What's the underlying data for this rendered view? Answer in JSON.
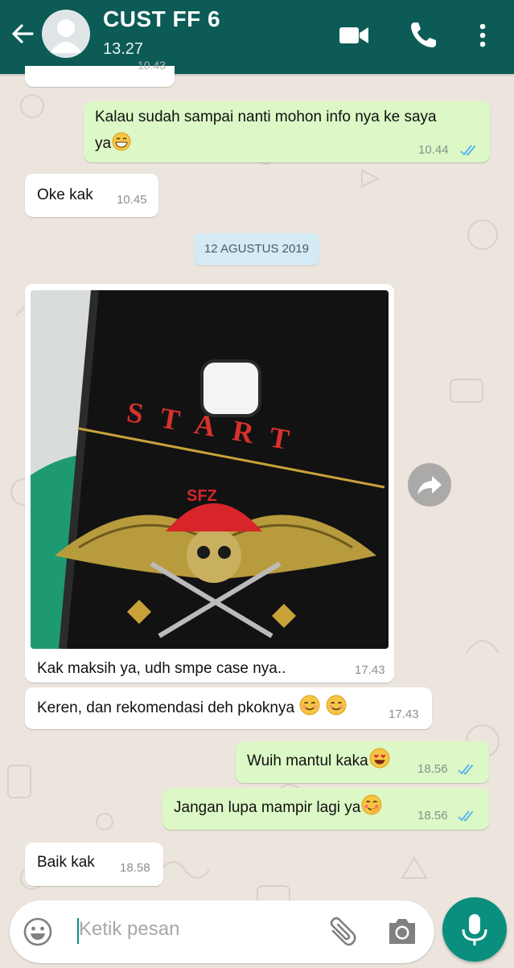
{
  "header": {
    "contact_name": "CUST FF 6",
    "last_seen": "13.27",
    "back_icon": "arrow-left-icon",
    "video_icon": "video-camera-icon",
    "call_icon": "phone-icon",
    "menu_icon": "more-vertical-icon"
  },
  "messages": {
    "partial_time": "10.43",
    "m1_line1": "Kalau sudah sampai nanti mohon info nya ke saya",
    "m1_line2": "ya",
    "m1_time": "10.44",
    "m2_text": "Oke kak",
    "m2_time": "10.45",
    "date_divider": "12 AGUSTUS 2019",
    "m3_caption": "Kak maksih ya, udh smpe case nya..",
    "m3_time": "17.43",
    "m3_image": {
      "case_top_text": "START",
      "case_emblem_text": "SFZ"
    },
    "m4_text": "Keren, dan rekomendasi deh pkoknya",
    "m4_time": "17.43",
    "m5_text": "Wuih mantul kaka",
    "m5_time": "18.56",
    "m6_text": "Jangan lupa mampir lagi ya",
    "m6_time": "18.56",
    "m7_text": "Baik kak",
    "m7_time": "18.58"
  },
  "composer": {
    "placeholder": "Ketik pesan",
    "emoji_icon": "smiley-icon",
    "attach_icon": "paperclip-icon",
    "camera_icon": "camera-icon",
    "mic_icon": "microphone-icon"
  },
  "colors": {
    "header": "#0c5b56",
    "outgoing_bubble": "#dcf8c6",
    "incoming_bubble": "#ffffff",
    "read_ticks": "#4fb6ec",
    "accent": "#0a8f7f"
  }
}
